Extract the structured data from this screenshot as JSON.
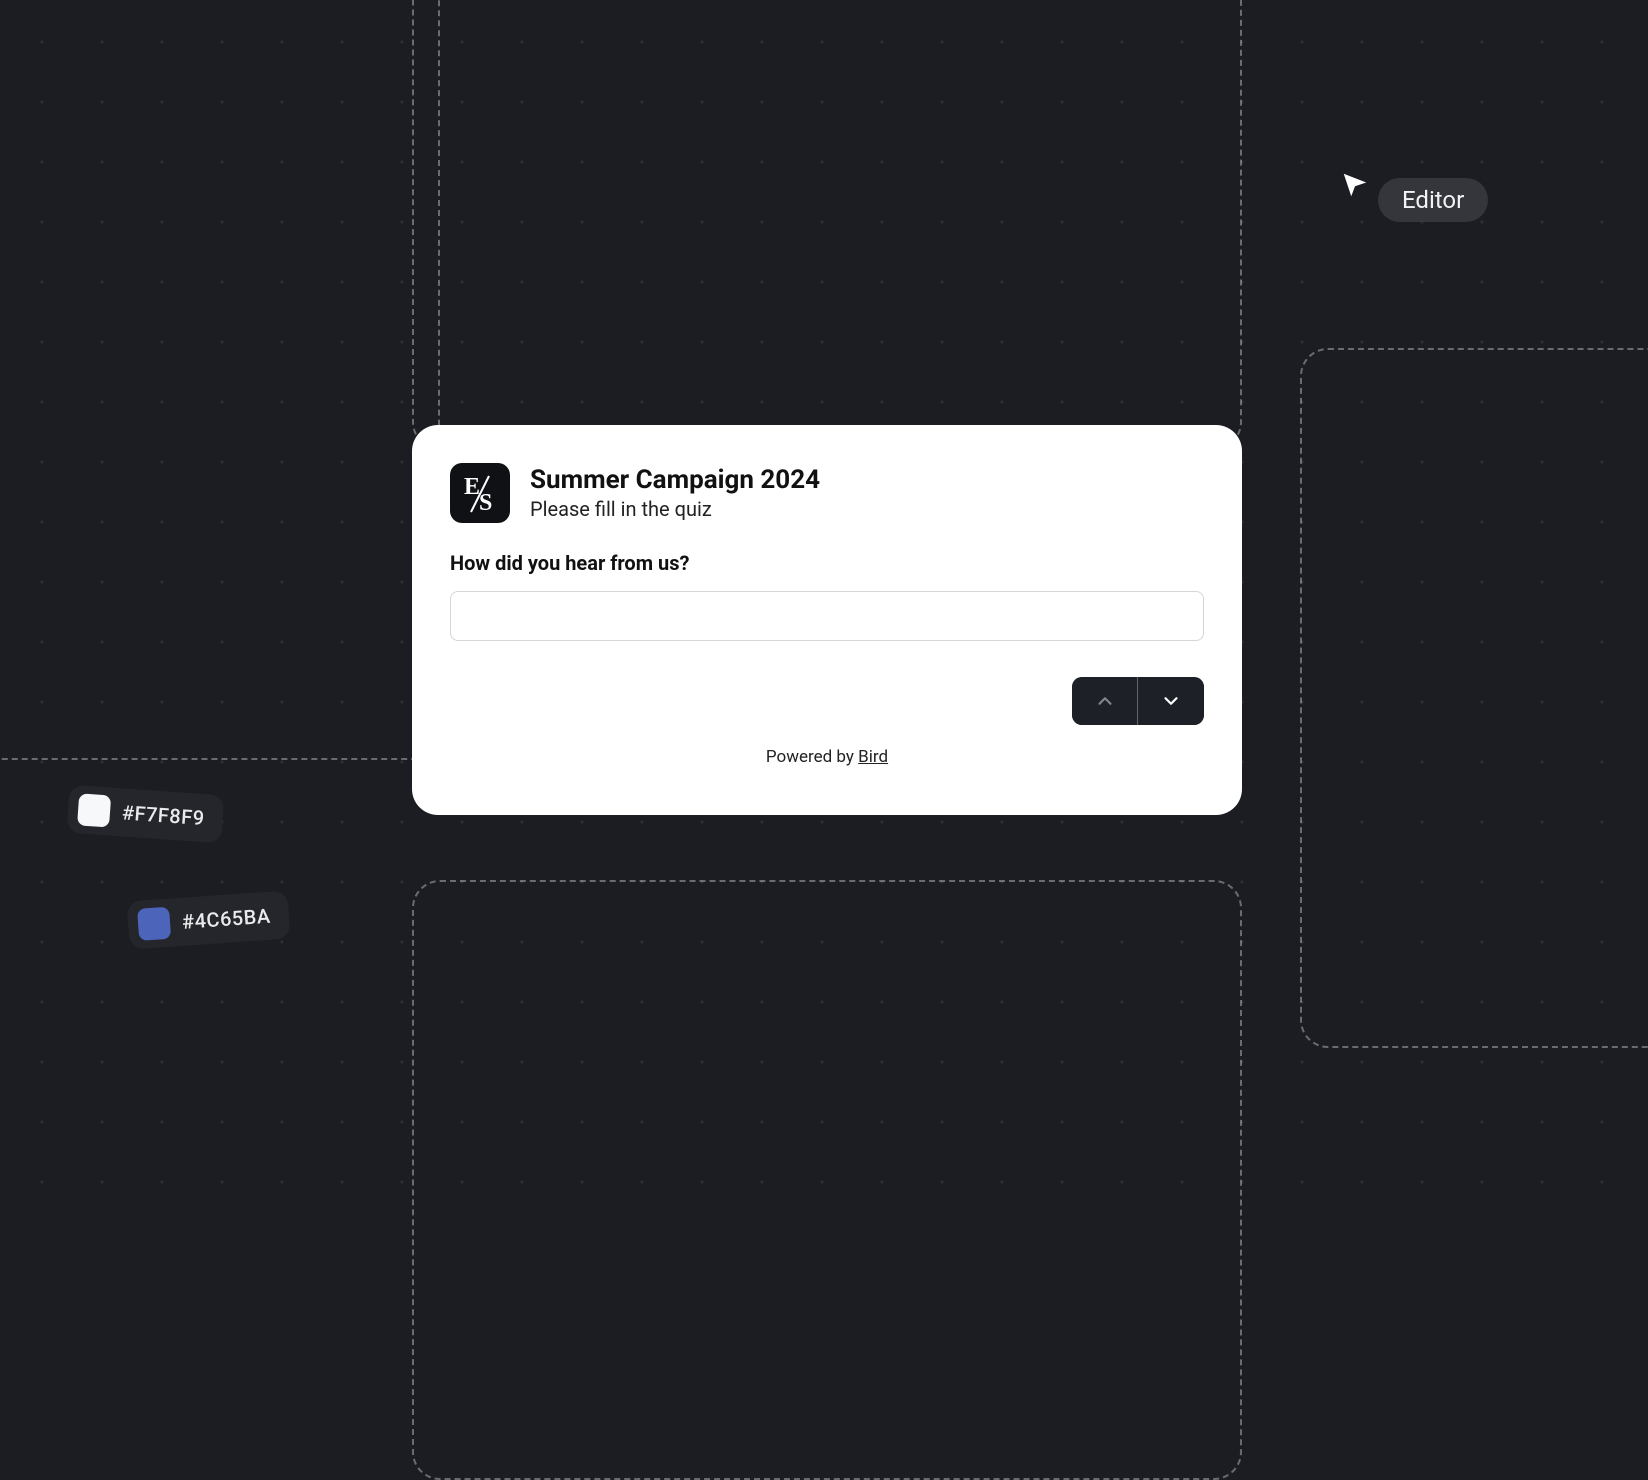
{
  "card": {
    "title": "Summer Campaign 2024",
    "subtitle": "Please fill in the quiz",
    "question": "How did you hear from us?",
    "input_value": "",
    "input_placeholder": ""
  },
  "footer": {
    "prefix": "Powered by ",
    "brand": "Bird"
  },
  "cursor": {
    "label": "Editor"
  },
  "chips": [
    {
      "hex": "#F7F8F9"
    },
    {
      "hex": "#4C65BA"
    }
  ]
}
